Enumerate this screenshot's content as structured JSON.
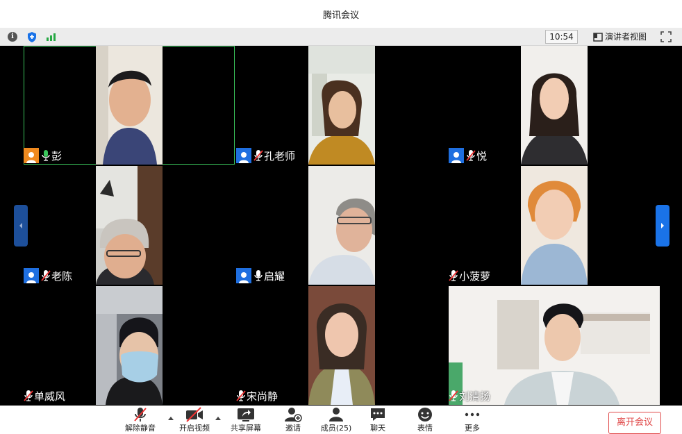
{
  "window": {
    "title": "腾讯会议"
  },
  "infobar": {
    "time": "10:54",
    "speaker_view_label": "演讲者视图"
  },
  "participants": [
    {
      "name": "彭"
    },
    {
      "name": "孔老师"
    },
    {
      "name": "悦"
    },
    {
      "name": "老陈"
    },
    {
      "name": "启耀"
    },
    {
      "name": "小菠萝"
    },
    {
      "name": "单威风"
    },
    {
      "name": "宋尚静"
    },
    {
      "name": "刘清扬"
    }
  ],
  "toolbar": {
    "unmute": "解除静音",
    "start_video": "开启视频",
    "share_screen": "共享屏幕",
    "invite": "邀请",
    "members": "成员(25)",
    "chat": "聊天",
    "reactions": "表情",
    "more": "更多",
    "leave": "离开会议"
  },
  "colors": {
    "accent": "#1a73e8",
    "active_speaker": "#3ac55b",
    "leave": "#e04848"
  }
}
